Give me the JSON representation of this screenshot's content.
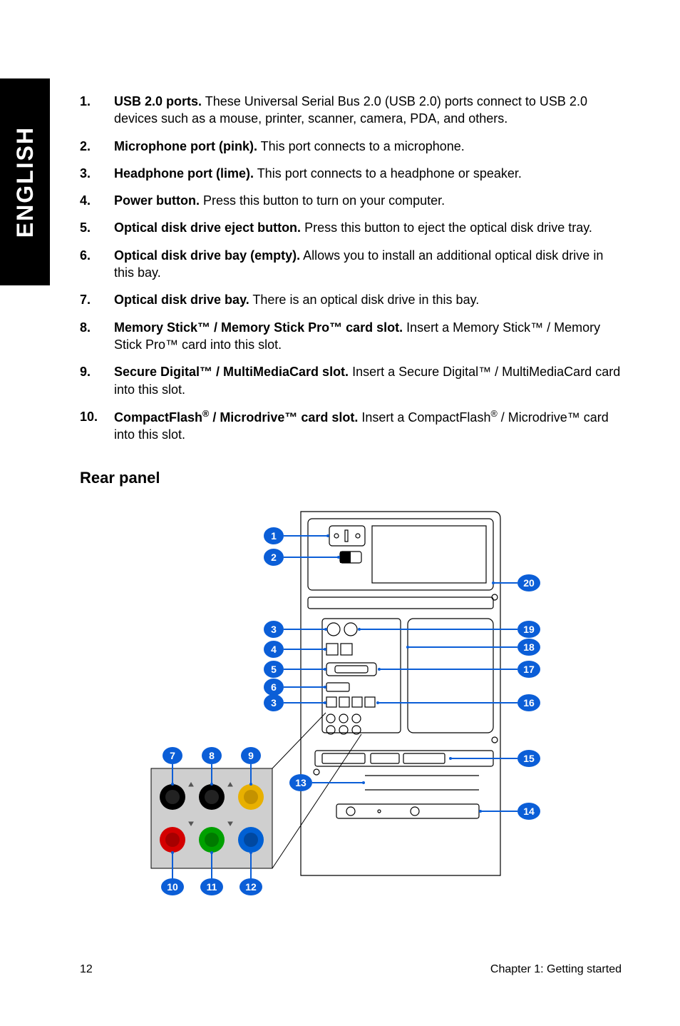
{
  "sideTab": "ENGLISH",
  "list": [
    {
      "n": "1.",
      "title": "USB 2.0 ports.",
      "desc": " These Universal Serial Bus 2.0 (USB 2.0) ports connect to USB 2.0 devices such as a mouse, printer, scanner, camera, PDA, and others."
    },
    {
      "n": "2.",
      "title": "Microphone port (pink).",
      "desc": " This port connects to a microphone."
    },
    {
      "n": "3.",
      "title": "Headphone port (lime).",
      "desc": " This port connects to a headphone or speaker."
    },
    {
      "n": "4.",
      "title": "Power button.",
      "desc": " Press this button to turn on your computer."
    },
    {
      "n": "5.",
      "title": "Optical disk drive eject button.",
      "desc": " Press this button to eject the optical disk drive tray."
    },
    {
      "n": "6.",
      "title": "Optical disk drive bay (empty).",
      "desc": " Allows you to install an additional optical disk drive in this bay."
    },
    {
      "n": "7.",
      "title": "Optical disk drive bay.",
      "desc": " There is an optical disk drive in this bay."
    },
    {
      "n": "8.",
      "title": "Memory Stick™ / Memory Stick Pro™ card slot.",
      "desc": " Insert a Memory Stick™ / Memory Stick Pro™ card into this slot."
    },
    {
      "n": "9.",
      "title": "Secure Digital™ / MultiMediaCard slot.",
      "desc": " Insert a Secure Digital™ / MultiMediaCard card into this slot."
    },
    {
      "n": "10.",
      "title": "CompactFlash® / Microdrive™ card slot.",
      "desc": " Insert a CompactFlash® / Microdrive™ card into this slot."
    }
  ],
  "sectionTitle": "Rear panel",
  "callouts": {
    "c1": "1",
    "c2": "2",
    "c3a": "3",
    "c3b": "3",
    "c4": "4",
    "c5": "5",
    "c6": "6",
    "c7": "7",
    "c8": "8",
    "c9": "9",
    "c10": "10",
    "c11": "11",
    "c12": "12",
    "c13": "13",
    "c14": "14",
    "c15": "15",
    "c16": "16",
    "c17": "17",
    "c18": "18",
    "c19": "19",
    "c20": "20"
  },
  "footer": {
    "page": "12",
    "chapter": "Chapter 1: Getting started"
  }
}
